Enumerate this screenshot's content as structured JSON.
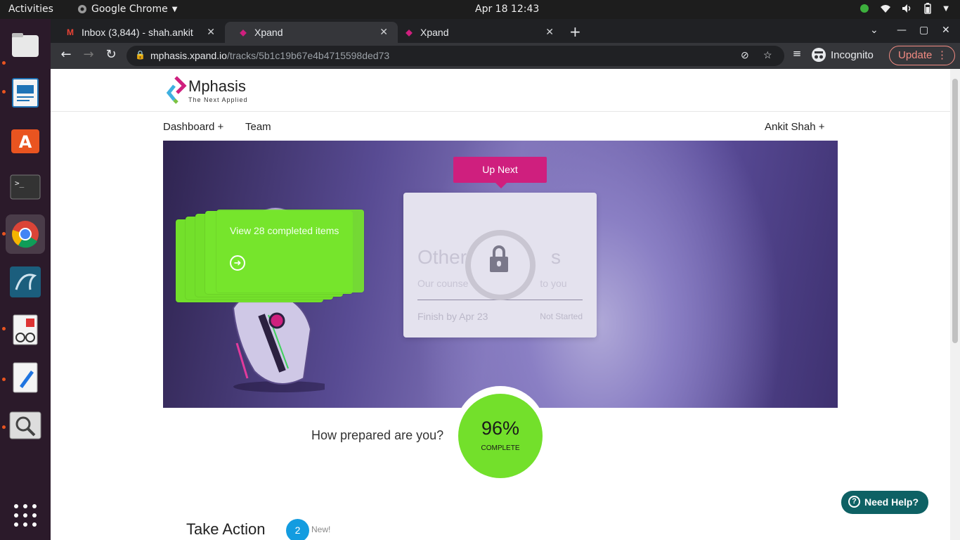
{
  "system": {
    "activities": "Activities",
    "app_menu": "Google Chrome",
    "clock": "Apr 18  12:43"
  },
  "browser": {
    "tabs": [
      {
        "title": "Inbox (3,844) - shah.ankit",
        "icon": "gmail-icon"
      },
      {
        "title": "Xpand",
        "icon": "xpand-icon"
      },
      {
        "title": "Xpand",
        "icon": "xpand-icon"
      }
    ],
    "url_domain": "mphasis.xpand.io",
    "url_path": "/tracks/5b1c19b67e4b4715598ded73",
    "incognito": "Incognito",
    "update": "Update"
  },
  "site": {
    "brand": "Mphasis",
    "tagline": "The Next Applied",
    "nav": {
      "dashboard": "Dashboard +",
      "team": "Team",
      "user": "Ankit Shah +"
    }
  },
  "hero": {
    "completed_text": "View 28 completed items",
    "up_next": "Up Next",
    "next_card": {
      "title": "Other",
      "title_end": "s",
      "subtitle": "Our counse",
      "subtitle_end": "to you",
      "finish": "Finish by Apr 23",
      "status": "Not Started"
    }
  },
  "progress": {
    "question": "How prepared are you?",
    "percent": "96%",
    "label": "COMPLETE",
    "value": 0.96
  },
  "take_action": {
    "title": "Take Action",
    "count": "2",
    "new_label": "New!"
  },
  "help": {
    "label": "Need Help?"
  },
  "colors": {
    "accent_green": "#73e02b",
    "accent_magenta": "#cf1f7e",
    "badge_blue": "#139ce0",
    "help_teal": "#0e6164"
  }
}
